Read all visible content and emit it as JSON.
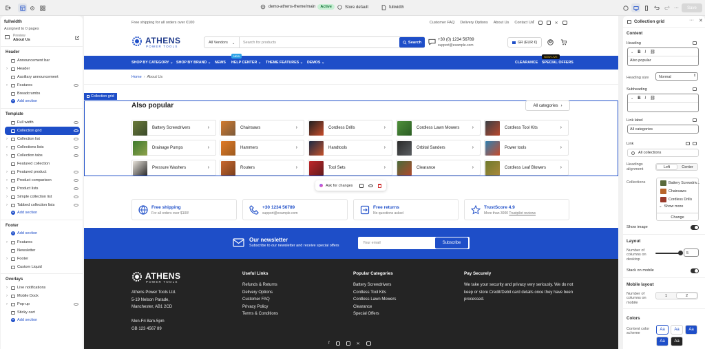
{
  "topbar": {
    "theme_name": "demo-athens-theme/main",
    "theme_status": "Active",
    "store": "Store default",
    "template": "fullwidth",
    "save_label": "Save"
  },
  "left": {
    "page_title": "fullwidth",
    "assigned": "Assigned to 0 pages",
    "preview_label": "Preview",
    "preview_value": "About Us",
    "header_section": "Header",
    "header_items": [
      "Announcement bar",
      "Header",
      "Auxiliary announcement",
      "Features",
      "Breadcrumbs"
    ],
    "add_section": "Add section",
    "template_section": "Template",
    "template_items": [
      "Full width",
      "Collection grid",
      "Collection list",
      "Collections lists",
      "Collection tabs",
      "Featured collection",
      "Featured product",
      "Product comparison",
      "Product lists",
      "Simple collection list",
      "Tabbed collection lists"
    ],
    "footer_section": "Footer",
    "footer_items": [
      "Features",
      "Newsletter",
      "Footer",
      "Custom Liquid"
    ],
    "overlays_section": "Overlays",
    "overlay_items": [
      "Live notifications",
      "Mobile Dock",
      "Pop-up",
      "Sticky cart"
    ]
  },
  "store": {
    "promo": "Free shipping for all orders over €100",
    "top_links": [
      "Customer FAQ",
      "Delivery Options",
      "About Us",
      "Contact Us"
    ],
    "logo": "ATHENS",
    "logo_sub": "POWER TOOLS",
    "vendor_select": "All Vendors",
    "search_placeholder": "Search for products",
    "search_button": "Search",
    "phone": "+30 (0) 1234 56789",
    "email": "support@example.com",
    "currency": "GR (EUR €)",
    "nav": [
      "SHOP BY CATEGORY",
      "SHOP BY BRAND",
      "NEWS",
      "HELP CENTER",
      "THEME FEATURES",
      "DEMOS"
    ],
    "nav_right": [
      "CLEARANCE",
      "SPECIAL OFFERS"
    ],
    "badge_new": "NEW",
    "badge_live": "NOW LIVE",
    "breadcrumb_home": "Home",
    "breadcrumb_sep": "›",
    "breadcrumb_current": "About Us",
    "section_tag": "Collection grid",
    "grid_title": "Also popular",
    "all_categories": "All categories",
    "collections": [
      "Battery Screwdrivers",
      "Chainsaws",
      "Cordless Drills",
      "Cordless Lawn Mowers",
      "Cordless Tool Kits",
      "Drainage Pumps",
      "Hammers",
      "Handtools",
      "Orbital Sanders",
      "Power tools",
      "Pressure Washers",
      "Routers",
      "Tool Sets",
      "Clearance",
      "Cordless Leaf Blowers"
    ],
    "ask_changes": "Ask for changes",
    "features": [
      {
        "title": "Free shipping",
        "sub": "For all orders over $100!"
      },
      {
        "title": "+30 1234 56789",
        "sub": "support@example.com"
      },
      {
        "title": "Free returns",
        "sub": "No questions asked"
      },
      {
        "title": "TrustScore 4.9",
        "sub": "More than 3000 ",
        "sub_link": "Trustpilot reviews"
      }
    ],
    "newsletter_title": "Our newsletter",
    "newsletter_sub": "Subscribe to our newsletter and receive special offers",
    "newsletter_placeholder": "Your email",
    "newsletter_button": "Subscribe",
    "footer": {
      "address": [
        "Athens Power Tools Ltd.",
        "5-19 Nelson Parade,",
        "Manchester, AB1 2CD",
        "",
        "Mon-Fri 8am-5pm",
        "GB 123 4567 89"
      ],
      "useful_title": "Useful Links",
      "useful": [
        "Refunds & Returns",
        "Delivery Options",
        "Customer FAQ",
        "Privacy Policy",
        "Terms & Conditions"
      ],
      "popular_title": "Popular Categories",
      "popular": [
        "Battery Screwdrivers",
        "Cordless Tool Kits",
        "Cordless Lawn Mowers",
        "Clearance",
        "Special Offers"
      ],
      "pay_title": "Pay Securely",
      "pay_text": "We take your security and privacy very seriously. We do not keep or store Credit/Debit card details once they have been processed."
    }
  },
  "right": {
    "title": "Collection grid",
    "content": "Content",
    "heading_label": "Heading",
    "heading_value": "Also popular",
    "heading_size_label": "Heading size",
    "heading_size_value": "Normal",
    "subheading_label": "Subheading",
    "link_label_label": "Link label",
    "link_label_value": "All categories",
    "link_label": "Link",
    "link_value": "All collections",
    "align_label": "Headings alignment",
    "align_options": [
      "Left",
      "Center"
    ],
    "collections_label": "Collections",
    "collections_items": [
      "Battery Screwdriv...",
      "Chainsaws",
      "Cordless Drills"
    ],
    "show_more": "Show more",
    "change": "Change",
    "show_image": "Show image",
    "layout": "Layout",
    "columns_desktop_label": "Number of columns on desktop",
    "columns_desktop_value": "5",
    "stack_mobile": "Stack on mobile",
    "mobile_layout": "Mobile layout",
    "columns_mobile_label": "Number of columns on mobile",
    "columns_mobile_options": [
      "1",
      "2"
    ],
    "colors": "Colors",
    "scheme_label": "Content color scheme",
    "scheme_sample": "Aa"
  }
}
